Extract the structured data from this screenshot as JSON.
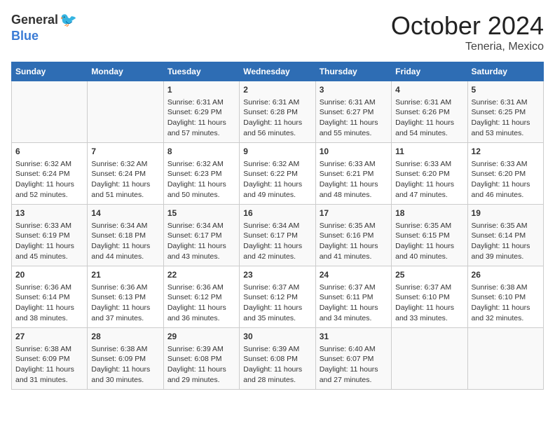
{
  "header": {
    "logo_general": "General",
    "logo_blue": "Blue",
    "month": "October 2024",
    "location": "Teneria, Mexico"
  },
  "calendar": {
    "days_of_week": [
      "Sunday",
      "Monday",
      "Tuesday",
      "Wednesday",
      "Thursday",
      "Friday",
      "Saturday"
    ],
    "weeks": [
      [
        {
          "day": "",
          "info": ""
        },
        {
          "day": "",
          "info": ""
        },
        {
          "day": "1",
          "info": "Sunrise: 6:31 AM\nSunset: 6:29 PM\nDaylight: 11 hours and 57 minutes."
        },
        {
          "day": "2",
          "info": "Sunrise: 6:31 AM\nSunset: 6:28 PM\nDaylight: 11 hours and 56 minutes."
        },
        {
          "day": "3",
          "info": "Sunrise: 6:31 AM\nSunset: 6:27 PM\nDaylight: 11 hours and 55 minutes."
        },
        {
          "day": "4",
          "info": "Sunrise: 6:31 AM\nSunset: 6:26 PM\nDaylight: 11 hours and 54 minutes."
        },
        {
          "day": "5",
          "info": "Sunrise: 6:31 AM\nSunset: 6:25 PM\nDaylight: 11 hours and 53 minutes."
        }
      ],
      [
        {
          "day": "6",
          "info": "Sunrise: 6:32 AM\nSunset: 6:24 PM\nDaylight: 11 hours and 52 minutes."
        },
        {
          "day": "7",
          "info": "Sunrise: 6:32 AM\nSunset: 6:24 PM\nDaylight: 11 hours and 51 minutes."
        },
        {
          "day": "8",
          "info": "Sunrise: 6:32 AM\nSunset: 6:23 PM\nDaylight: 11 hours and 50 minutes."
        },
        {
          "day": "9",
          "info": "Sunrise: 6:32 AM\nSunset: 6:22 PM\nDaylight: 11 hours and 49 minutes."
        },
        {
          "day": "10",
          "info": "Sunrise: 6:33 AM\nSunset: 6:21 PM\nDaylight: 11 hours and 48 minutes."
        },
        {
          "day": "11",
          "info": "Sunrise: 6:33 AM\nSunset: 6:20 PM\nDaylight: 11 hours and 47 minutes."
        },
        {
          "day": "12",
          "info": "Sunrise: 6:33 AM\nSunset: 6:20 PM\nDaylight: 11 hours and 46 minutes."
        }
      ],
      [
        {
          "day": "13",
          "info": "Sunrise: 6:33 AM\nSunset: 6:19 PM\nDaylight: 11 hours and 45 minutes."
        },
        {
          "day": "14",
          "info": "Sunrise: 6:34 AM\nSunset: 6:18 PM\nDaylight: 11 hours and 44 minutes."
        },
        {
          "day": "15",
          "info": "Sunrise: 6:34 AM\nSunset: 6:17 PM\nDaylight: 11 hours and 43 minutes."
        },
        {
          "day": "16",
          "info": "Sunrise: 6:34 AM\nSunset: 6:17 PM\nDaylight: 11 hours and 42 minutes."
        },
        {
          "day": "17",
          "info": "Sunrise: 6:35 AM\nSunset: 6:16 PM\nDaylight: 11 hours and 41 minutes."
        },
        {
          "day": "18",
          "info": "Sunrise: 6:35 AM\nSunset: 6:15 PM\nDaylight: 11 hours and 40 minutes."
        },
        {
          "day": "19",
          "info": "Sunrise: 6:35 AM\nSunset: 6:14 PM\nDaylight: 11 hours and 39 minutes."
        }
      ],
      [
        {
          "day": "20",
          "info": "Sunrise: 6:36 AM\nSunset: 6:14 PM\nDaylight: 11 hours and 38 minutes."
        },
        {
          "day": "21",
          "info": "Sunrise: 6:36 AM\nSunset: 6:13 PM\nDaylight: 11 hours and 37 minutes."
        },
        {
          "day": "22",
          "info": "Sunrise: 6:36 AM\nSunset: 6:12 PM\nDaylight: 11 hours and 36 minutes."
        },
        {
          "day": "23",
          "info": "Sunrise: 6:37 AM\nSunset: 6:12 PM\nDaylight: 11 hours and 35 minutes."
        },
        {
          "day": "24",
          "info": "Sunrise: 6:37 AM\nSunset: 6:11 PM\nDaylight: 11 hours and 34 minutes."
        },
        {
          "day": "25",
          "info": "Sunrise: 6:37 AM\nSunset: 6:10 PM\nDaylight: 11 hours and 33 minutes."
        },
        {
          "day": "26",
          "info": "Sunrise: 6:38 AM\nSunset: 6:10 PM\nDaylight: 11 hours and 32 minutes."
        }
      ],
      [
        {
          "day": "27",
          "info": "Sunrise: 6:38 AM\nSunset: 6:09 PM\nDaylight: 11 hours and 31 minutes."
        },
        {
          "day": "28",
          "info": "Sunrise: 6:38 AM\nSunset: 6:09 PM\nDaylight: 11 hours and 30 minutes."
        },
        {
          "day": "29",
          "info": "Sunrise: 6:39 AM\nSunset: 6:08 PM\nDaylight: 11 hours and 29 minutes."
        },
        {
          "day": "30",
          "info": "Sunrise: 6:39 AM\nSunset: 6:08 PM\nDaylight: 11 hours and 28 minutes."
        },
        {
          "day": "31",
          "info": "Sunrise: 6:40 AM\nSunset: 6:07 PM\nDaylight: 11 hours and 27 minutes."
        },
        {
          "day": "",
          "info": ""
        },
        {
          "day": "",
          "info": ""
        }
      ]
    ]
  }
}
